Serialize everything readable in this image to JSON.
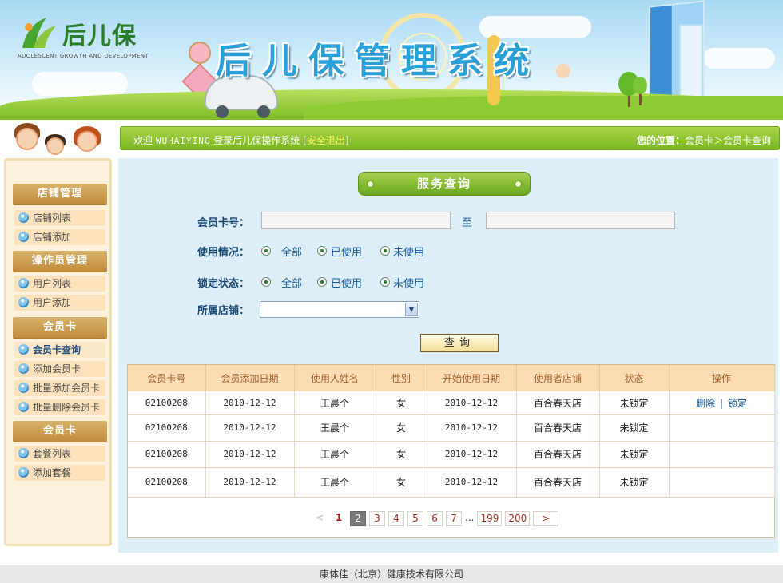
{
  "logo": {
    "name": "后儿保",
    "subtitle": "ADOLESCENT GROWTH AND DEVELOPMENT"
  },
  "banner": {
    "title": "后儿保管理系统"
  },
  "topbar": {
    "welcome_prefix": "欢迎",
    "username": "WUHAIYING",
    "welcome_suffix": "登录后儿保操作系统",
    "bracket_open": "[",
    "logout": "安全退出",
    "bracket_close": "]",
    "location_label": "您的位置：",
    "breadcrumb": [
      "会员卡",
      "会员卡查询"
    ],
    "breadcrumb_sep": "＞"
  },
  "sidebar": {
    "sections": [
      {
        "title": "店铺管理",
        "items": [
          "店铺列表",
          "店铺添加"
        ]
      },
      {
        "title": "操作员管理",
        "items": [
          "用户列表",
          "用户添加"
        ]
      },
      {
        "title": "会员卡",
        "items": [
          "会员卡查询",
          "添加会员卡",
          "批量添加会员卡",
          "批量删除会员卡"
        ]
      },
      {
        "title": "会员卡",
        "items": [
          "套餐列表",
          "添加套餐"
        ]
      }
    ],
    "active_item": "会员卡查询"
  },
  "panel": {
    "title": "服务查询"
  },
  "form": {
    "card_label": "会员卡号：",
    "card_from": "",
    "to_text": "至",
    "card_to": "",
    "usage_label": "使用情况：",
    "usage_options": [
      "全部",
      "已使用",
      "未使用"
    ],
    "lock_label": "锁定状态：",
    "lock_options": [
      "全部",
      "已使用",
      "未使用"
    ],
    "store_label": "所属店铺：",
    "store_value": "",
    "query_button": "查询"
  },
  "table": {
    "headers": [
      "会员卡号",
      "会员添加日期",
      "使用人姓名",
      "性别",
      "开始使用日期",
      "使用者店铺",
      "状态",
      "操作"
    ],
    "rows": [
      {
        "card": "02100208",
        "added": "2010-12-12",
        "name": "王晨个",
        "gender": "女",
        "start": "2010-12-12",
        "store": "百合春天店",
        "status": "未锁定",
        "actions": [
          "删除",
          "锁定"
        ]
      },
      {
        "card": "02100208",
        "added": "2010-12-12",
        "name": "王晨个",
        "gender": "女",
        "start": "2010-12-12",
        "store": "百合春天店",
        "status": "未锁定",
        "actions": []
      },
      {
        "card": "02100208",
        "added": "2010-12-12",
        "name": "王晨个",
        "gender": "女",
        "start": "2010-12-12",
        "store": "百合春天店",
        "status": "未锁定",
        "actions": []
      },
      {
        "card": "02100208",
        "added": "2010-12-12",
        "name": "王晨个",
        "gender": "女",
        "start": "2010-12-12",
        "store": "百合春天店",
        "status": "未锁定",
        "actions": []
      }
    ],
    "action_sep": "|"
  },
  "pager": {
    "prev": "<",
    "current_plain": "1",
    "pages": [
      "2",
      "3",
      "4",
      "5",
      "6",
      "7"
    ],
    "dots": "...",
    "tail_pages": [
      "199",
      "200"
    ],
    "next": ">"
  },
  "footer": {
    "text": "康体佳（北京）健康技术有限公司"
  },
  "colors": {
    "accent_green": "#7cb722",
    "panel_bg": "#ddeef8",
    "menu_head": "#c08b3b",
    "link_blue": "#1a5c9a"
  }
}
